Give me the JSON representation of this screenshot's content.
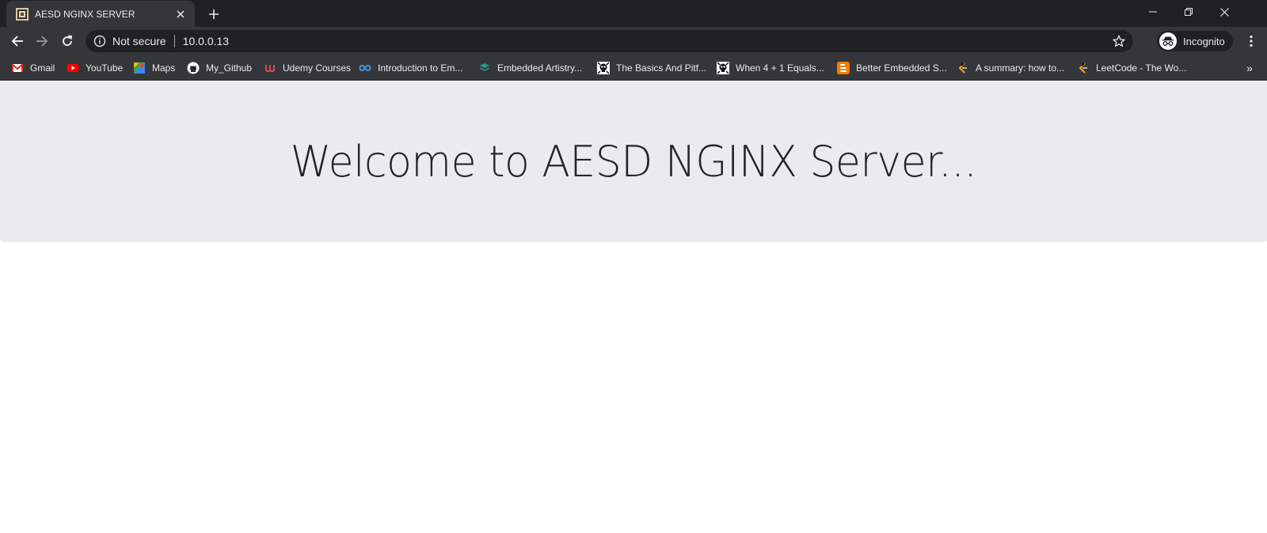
{
  "browser": {
    "tab": {
      "title": "AESD NGINX SERVER"
    },
    "address_bar": {
      "security_label": "Not secure",
      "url": "10.0.0.13"
    },
    "profile": {
      "label": "Incognito"
    },
    "bookmarks": [
      {
        "label": "Gmail",
        "icon": "gmail-icon"
      },
      {
        "label": "YouTube",
        "icon": "youtube-icon"
      },
      {
        "label": "Maps",
        "icon": "maps-icon"
      },
      {
        "label": "My_Github",
        "icon": "github-icon"
      },
      {
        "label": "Udemy Courses",
        "icon": "udemy-icon"
      },
      {
        "label": "Introduction to Em...",
        "icon": "infinity-icon"
      },
      {
        "label": "Embedded Artistry...",
        "icon": "embedded-artistry-icon"
      },
      {
        "label": "The Basics And Pitf...",
        "icon": "skull-icon"
      },
      {
        "label": "When 4 + 1 Equals...",
        "icon": "skull-icon"
      },
      {
        "label": "Better Embedded S...",
        "icon": "blogger-icon"
      },
      {
        "label": "A summary: how to...",
        "icon": "leetcode-icon"
      },
      {
        "label": "LeetCode - The Wo...",
        "icon": "leetcode-icon"
      }
    ],
    "colors": {
      "frame": "#202124",
      "toolbar": "#35363a",
      "text": "#e8eaed"
    }
  },
  "page": {
    "heading": "Welcome to AESD NGINX Server...",
    "colors": {
      "jumbotron_bg": "#e9ecef",
      "heading": "#212529"
    }
  }
}
